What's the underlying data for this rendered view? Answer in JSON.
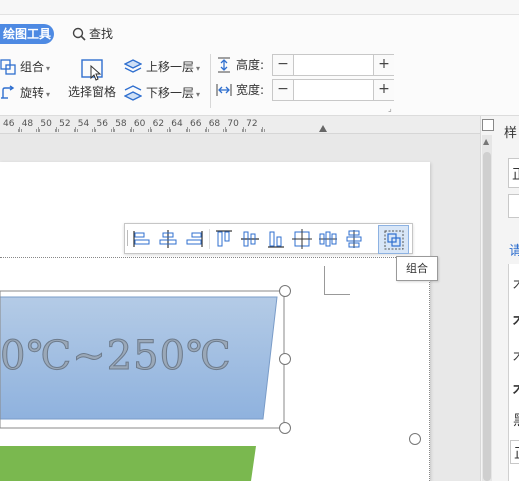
{
  "ribbon": {
    "tab_draw": "绘图工具",
    "tab_find": "查找",
    "group_label": "组合",
    "rotate_label": "旋转",
    "selection_pane_label": "选择窗格",
    "bring_forward_label": "上移一层",
    "send_backward_label": "下移一层",
    "height_label": "高度:",
    "width_label": "宽度:",
    "height_value": "",
    "width_value": "",
    "minus": "−",
    "plus": "+"
  },
  "ruler": {
    "labels": [
      "46",
      "48",
      "50",
      "52",
      "54",
      "56",
      "58",
      "60",
      "62",
      "64",
      "66",
      "68",
      "70",
      "72"
    ]
  },
  "align_toolbar": {
    "buttons": [
      "align-left",
      "align-center",
      "align-right",
      "align-top",
      "align-middle",
      "align-bottom",
      "center-both",
      "distribute-horizontal",
      "distribute-vertical",
      "group"
    ],
    "tooltip": "组合"
  },
  "shape": {
    "text": "0℃~250℃",
    "fill_top": "#b4cbe6",
    "fill_bottom": "#8fb2de",
    "green_fill": "#7ab84f"
  },
  "right_panel": {
    "tab_label": "样",
    "blue_label": "请",
    "chars": [
      "正",
      "",
      "木",
      "木",
      "木",
      "木",
      "黑",
      "正"
    ]
  },
  "colors": {
    "accent": "#4e8ae3",
    "ribbon_bg": "#fbfbfb"
  }
}
